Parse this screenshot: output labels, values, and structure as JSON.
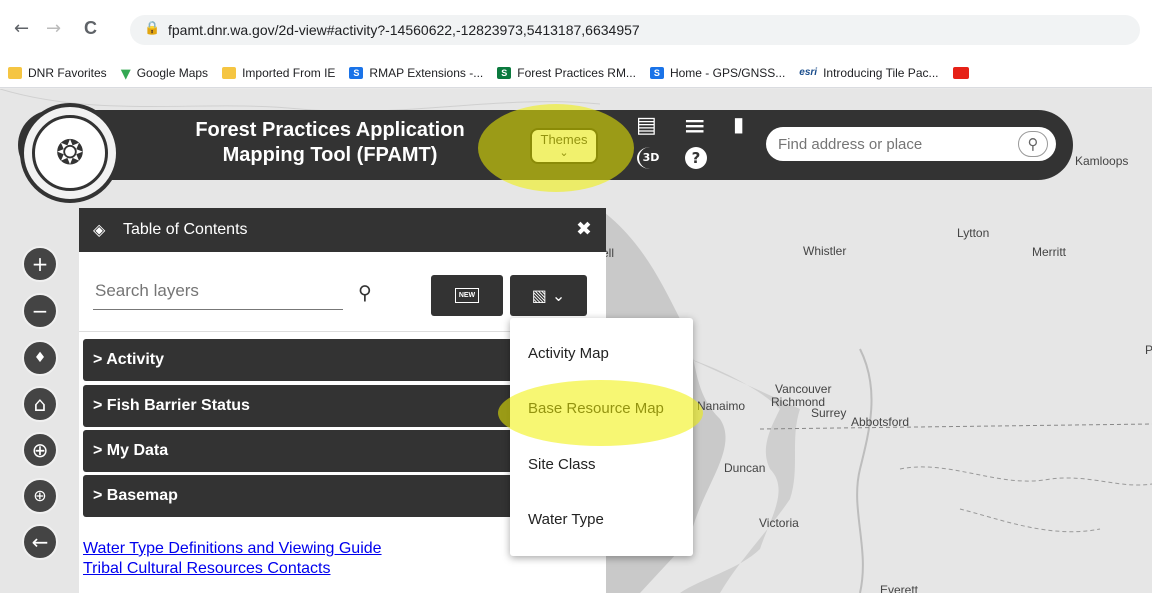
{
  "browser": {
    "back": "←",
    "forward": "→",
    "reload": "C",
    "lock": "🔒",
    "url": "fpamt.dnr.wa.gov/2d-view#activity?-14560622,-12823973,5413187,6634957"
  },
  "bookmarks": [
    {
      "label": "DNR Favorites",
      "icon": "folder-icon"
    },
    {
      "label": "Google Maps",
      "icon": "map-pin-icon"
    },
    {
      "label": "Imported From IE",
      "icon": "folder-icon"
    },
    {
      "label": "RMAP Extensions -...",
      "icon": "sharepoint-icon"
    },
    {
      "label": "Forest Practices RM...",
      "icon": "sharepoint-icon"
    },
    {
      "label": "Home - GPS/GNSS...",
      "icon": "sharepoint-icon"
    },
    {
      "label": "Introducing Tile Pac...",
      "icon": "esri-icon"
    },
    {
      "label": "",
      "icon": "youtube-icon"
    }
  ],
  "bookmark_icon_text": {
    "sharepoint": "S",
    "esri": "esri"
  },
  "header": {
    "title_line1": "Forest Practices Application",
    "title_line2": "Mapping Tool (FPAMT)",
    "themes_label": "Themes",
    "themes_chevron": "⌄",
    "search_placeholder": "Find address or place",
    "icons": {
      "contact": "▤",
      "menu": "≡",
      "map": "▮",
      "threed": "3D",
      "help": "?",
      "search": "⚲"
    }
  },
  "map_labels": {
    "kamloops": "Kamloops",
    "whistler": "Whistler",
    "lytton": "Lytton",
    "merritt": "Merritt",
    "vancouver": "Vancouver",
    "richmond": "Richmond",
    "surrey": "Surrey",
    "abbotsford": "Abbotsford",
    "nanaimo": "Nanaimo",
    "duncan": "Duncan",
    "victoria": "Victoria",
    "everett": "Everett",
    "ell": "ell",
    "p": "P"
  },
  "map_controls": {
    "zoom_in": "+",
    "zoom_out": "−",
    "compass": "♦",
    "home": "⌂",
    "locate": "⊕",
    "zoom_box": "⊕",
    "back": "←"
  },
  "toc": {
    "title": "Table of Contents",
    "layers_icon": "◈",
    "close": "✖",
    "search_placeholder": "Search layers",
    "search_icon": "⚲",
    "new_label": "NEW",
    "image_icon": "▧ ⌄",
    "sections": [
      {
        "label": "> Activity"
      },
      {
        "label": "> Fish Barrier Status"
      },
      {
        "label": "> My Data"
      },
      {
        "label": "> Basemap"
      }
    ],
    "links": [
      "Water Type Definitions and Viewing Guide",
      "Tribal Cultural Resources Contacts"
    ]
  },
  "dropdown": {
    "items": [
      "Activity Map",
      "Base Resource Map",
      "Site Class",
      "Water Type"
    ]
  },
  "colors": {
    "panel": "#333333",
    "highlight": "#f0f000",
    "link": "#0000ee"
  }
}
